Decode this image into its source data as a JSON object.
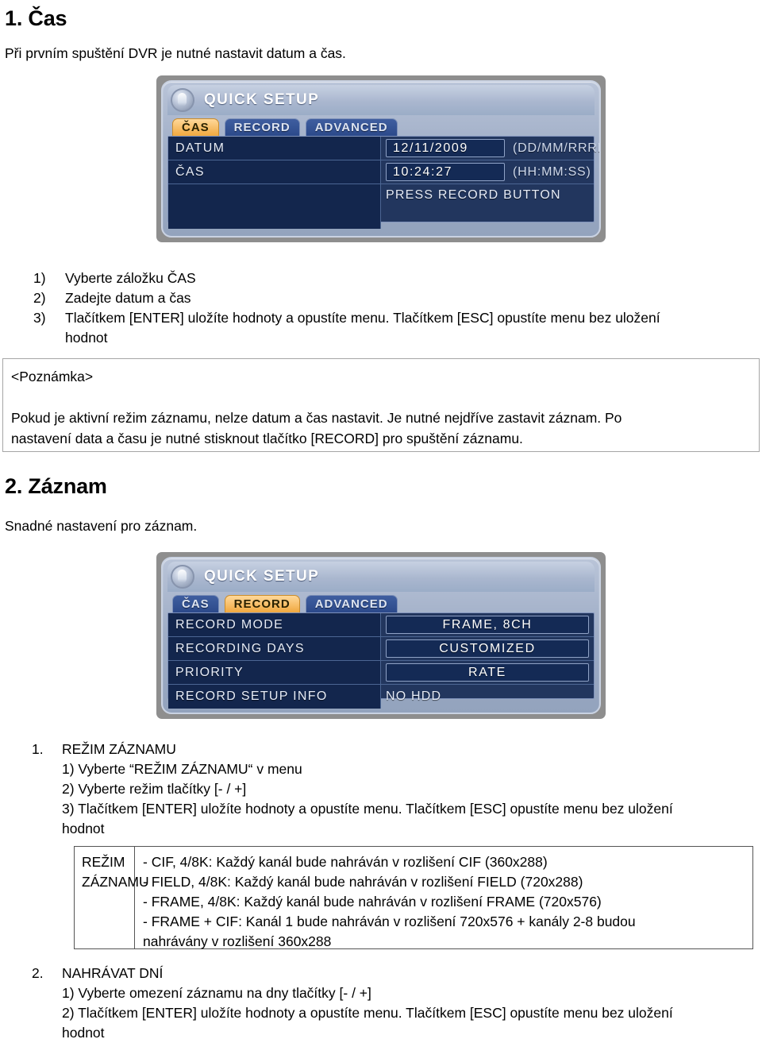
{
  "sections": [
    {
      "heading": "1. Čas",
      "intro": "Při prvním spuštění DVR je nutné nastavit datum a čas."
    },
    {
      "heading": "2. Záznam",
      "intro": "Snadné nastavení pro záznam."
    }
  ],
  "time_panel": {
    "title": "QUICK SETUP",
    "tabs": [
      {
        "label": "ČAS",
        "active": true
      },
      {
        "label": "RECORD",
        "active": false
      },
      {
        "label": "ADVANCED",
        "active": false
      }
    ],
    "rows": [
      {
        "label": "DATUM",
        "value": "12/11/2009",
        "hint": "(DD/MM/RRRR)"
      },
      {
        "label": "ČAS",
        "value": "10:24:27",
        "hint": "(HH:MM:SS)"
      }
    ],
    "footer_note": "PRESS RECORD BUTTON"
  },
  "record_panel": {
    "title": "QUICK SETUP",
    "tabs": [
      {
        "label": "ČAS",
        "active": false
      },
      {
        "label": "RECORD",
        "active": true
      },
      {
        "label": "ADVANCED",
        "active": false
      }
    ],
    "rows": [
      {
        "label": "RECORD MODE",
        "value": "FRAME, 8CH"
      },
      {
        "label": "RECORDING DAYS",
        "value": "CUSTOMIZED"
      },
      {
        "label": "PRIORITY",
        "value": "RATE"
      }
    ],
    "info_row": {
      "label": "RECORD SETUP INFO",
      "value": "NO HDD"
    }
  },
  "time_steps": [
    {
      "num": "1)",
      "text": "Vyberte záložku ČAS"
    },
    {
      "num": "2)",
      "text": "Zadejte datum a čas"
    },
    {
      "num": "3)",
      "text": "Tlačítkem [ENTER] uložíte hodnoty a opustíte menu. Tlačítkem [ESC] opustíte menu bez uložení"
    },
    {
      "num": "",
      "text": "hodnot"
    }
  ],
  "note": {
    "title": "<Poznámka>",
    "line1": "Pokud je aktivní režim záznamu, nelze datum a čas nastavit. Je nutné nejdříve zastavit záznam. Po",
    "line2": "nastavení data a času je nutné stisknout tlačítko [RECORD] pro spuštění záznamu."
  },
  "record_mode_section": {
    "number": "1.",
    "title": "REŽIM ZÁZNAMU",
    "steps": [
      "1) Vyberte “REŽIM ZÁZNAMU“ v menu",
      "2) Vyberte režim tlačítky [- / +]",
      "3) Tlačítkem [ENTER] uložíte hodnoty a opustíte menu. Tlačítkem [ESC] opustíte menu bez uložení",
      "hodnot"
    ]
  },
  "mode_table": {
    "label_line1": "REŽIM",
    "label_line2": "ZÁZNAMU",
    "rows": [
      "- CIF, 4/8K: Každý kanál bude nahráván v rozlišení CIF (360x288)",
      "- FIELD, 4/8K: Každý kanál bude nahráván v rozlišení FIELD (720x288)",
      "- FRAME, 4/8K: Každý kanál bude nahráván v rozlišení FRAME (720x576)",
      "- FRAME + CIF: Kanál 1 bude nahráván v rozlišení 720x576 + kanály 2-8 budou",
      "nahrávány v rozlišení 360x288"
    ]
  },
  "days_section": {
    "number": "2.",
    "title": "NAHRÁVAT DNÍ",
    "steps": [
      "1) Vyberte omezení záznamu na dny tlačítky [- / +]",
      "2) Tlačítkem [ENTER] uložíte hodnoty a opustíte menu. Tlačítkem [ESC] opustíte menu bez uložení",
      "hodnot"
    ]
  }
}
